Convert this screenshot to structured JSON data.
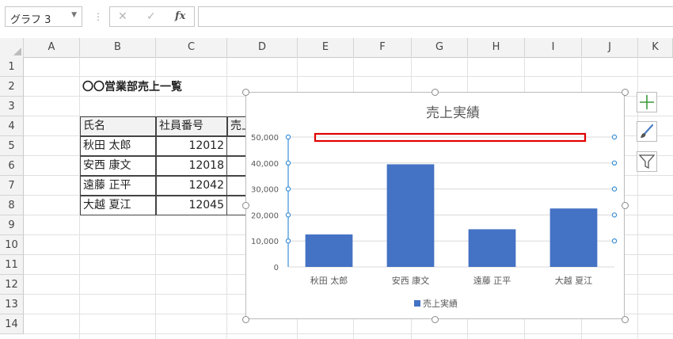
{
  "formula_bar": {
    "name_box": "グラフ 3",
    "cancel_glyph": "✕",
    "enter_glyph": "✓",
    "fx_label": "fx",
    "formula": ""
  },
  "columns": [
    "A",
    "B",
    "C",
    "D",
    "E",
    "F",
    "G",
    "H",
    "I",
    "J",
    "K"
  ],
  "rows": [
    "1",
    "2",
    "3",
    "4",
    "5",
    "6",
    "7",
    "8",
    "9",
    "10",
    "11",
    "12",
    "13",
    "14"
  ],
  "sheet": {
    "heading": "〇〇営業部売上一覧",
    "table_headers": [
      "氏名",
      "社員番号",
      "売上実績"
    ],
    "table_rows": [
      {
        "name": "秋田 太郎",
        "id": "12012"
      },
      {
        "name": "安西 康文",
        "id": "12018"
      },
      {
        "name": "遠藤 正平",
        "id": "12042"
      },
      {
        "name": "大越 夏江",
        "id": "12045"
      }
    ]
  },
  "chart_data": {
    "type": "bar",
    "title": "売上実績",
    "categories": [
      "秋田 太郎",
      "安西 康文",
      "遠藤 正平",
      "大越 夏江"
    ],
    "series": [
      {
        "name": "売上実績",
        "values": [
          12500,
          39500,
          14500,
          22500
        ],
        "color": "#4472c4"
      }
    ],
    "yticks": [
      "0",
      "10,000",
      "20,000",
      "30,000",
      "40,000",
      "50,000"
    ],
    "ylim": [
      0,
      50000
    ],
    "grid": true,
    "legend": "bottom",
    "selection_color": "#e00000"
  }
}
